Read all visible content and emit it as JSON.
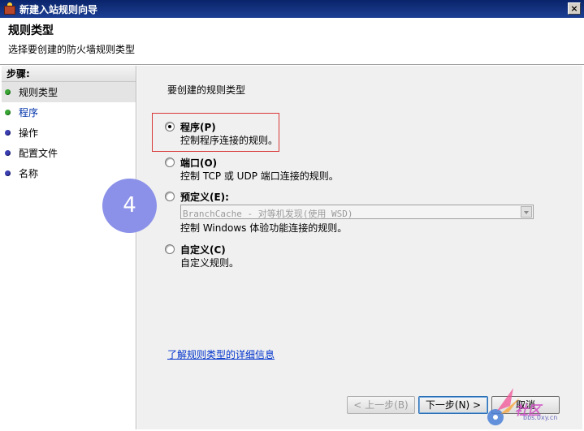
{
  "window": {
    "title": "新建入站规则向导",
    "close_glyph": "×"
  },
  "header": {
    "title": "规则类型",
    "subtitle": "选择要创建的防火墙规则类型"
  },
  "sidebar": {
    "title": "步骤:",
    "steps": [
      {
        "label": "规则类型",
        "state": "current"
      },
      {
        "label": "程序",
        "state": "next"
      },
      {
        "label": "操作",
        "state": "pending"
      },
      {
        "label": "配置文件",
        "state": "pending"
      },
      {
        "label": "名称",
        "state": "pending"
      }
    ]
  },
  "main": {
    "question": "要创建的规则类型",
    "options": [
      {
        "title": "程序(P)",
        "desc": "控制程序连接的规则。",
        "checked": true
      },
      {
        "title": "端口(O)",
        "desc": "控制 TCP 或 UDP 端口连接的规则。",
        "checked": false
      },
      {
        "title": "预定义(E):",
        "desc": "控制 Windows 体验功能连接的规则。",
        "checked": false,
        "combo_value": "BranchCache - 对等机发现(使用 WSD)"
      },
      {
        "title": "自定义(C)",
        "desc": "自定义规则。",
        "checked": false
      }
    ],
    "learn_more": "了解规则类型的详细信息"
  },
  "buttons": {
    "back": "< 上一步(B)",
    "next": "下一步(N) >",
    "cancel": "取消"
  },
  "overlay": {
    "step_number": "4"
  },
  "watermark": {
    "text": "社区",
    "sub": "bbs.0xy.cn"
  },
  "colors": {
    "titlebar": "#0a246a",
    "badge": "#8b91e8",
    "highlight": "#d93838",
    "link": "#0033cc"
  }
}
